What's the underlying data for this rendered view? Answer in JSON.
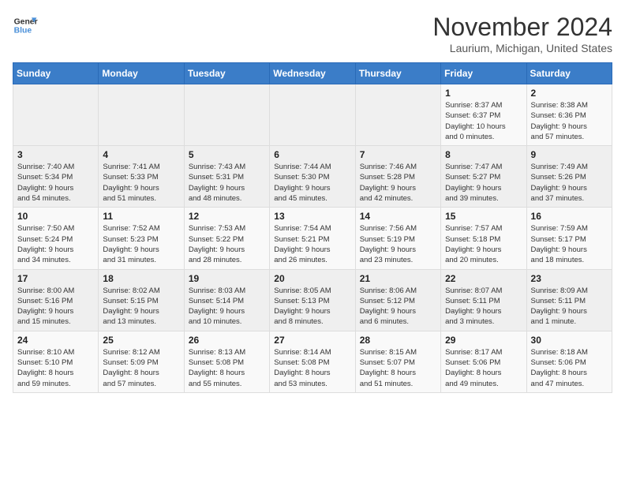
{
  "header": {
    "logo_line1": "General",
    "logo_line2": "Blue",
    "month_year": "November 2024",
    "location": "Laurium, Michigan, United States"
  },
  "weekdays": [
    "Sunday",
    "Monday",
    "Tuesday",
    "Wednesday",
    "Thursday",
    "Friday",
    "Saturday"
  ],
  "weeks": [
    [
      {
        "day": "",
        "info": ""
      },
      {
        "day": "",
        "info": ""
      },
      {
        "day": "",
        "info": ""
      },
      {
        "day": "",
        "info": ""
      },
      {
        "day": "",
        "info": ""
      },
      {
        "day": "1",
        "info": "Sunrise: 8:37 AM\nSunset: 6:37 PM\nDaylight: 10 hours\nand 0 minutes."
      },
      {
        "day": "2",
        "info": "Sunrise: 8:38 AM\nSunset: 6:36 PM\nDaylight: 9 hours\nand 57 minutes."
      }
    ],
    [
      {
        "day": "3",
        "info": "Sunrise: 7:40 AM\nSunset: 5:34 PM\nDaylight: 9 hours\nand 54 minutes."
      },
      {
        "day": "4",
        "info": "Sunrise: 7:41 AM\nSunset: 5:33 PM\nDaylight: 9 hours\nand 51 minutes."
      },
      {
        "day": "5",
        "info": "Sunrise: 7:43 AM\nSunset: 5:31 PM\nDaylight: 9 hours\nand 48 minutes."
      },
      {
        "day": "6",
        "info": "Sunrise: 7:44 AM\nSunset: 5:30 PM\nDaylight: 9 hours\nand 45 minutes."
      },
      {
        "day": "7",
        "info": "Sunrise: 7:46 AM\nSunset: 5:28 PM\nDaylight: 9 hours\nand 42 minutes."
      },
      {
        "day": "8",
        "info": "Sunrise: 7:47 AM\nSunset: 5:27 PM\nDaylight: 9 hours\nand 39 minutes."
      },
      {
        "day": "9",
        "info": "Sunrise: 7:49 AM\nSunset: 5:26 PM\nDaylight: 9 hours\nand 37 minutes."
      }
    ],
    [
      {
        "day": "10",
        "info": "Sunrise: 7:50 AM\nSunset: 5:24 PM\nDaylight: 9 hours\nand 34 minutes."
      },
      {
        "day": "11",
        "info": "Sunrise: 7:52 AM\nSunset: 5:23 PM\nDaylight: 9 hours\nand 31 minutes."
      },
      {
        "day": "12",
        "info": "Sunrise: 7:53 AM\nSunset: 5:22 PM\nDaylight: 9 hours\nand 28 minutes."
      },
      {
        "day": "13",
        "info": "Sunrise: 7:54 AM\nSunset: 5:21 PM\nDaylight: 9 hours\nand 26 minutes."
      },
      {
        "day": "14",
        "info": "Sunrise: 7:56 AM\nSunset: 5:19 PM\nDaylight: 9 hours\nand 23 minutes."
      },
      {
        "day": "15",
        "info": "Sunrise: 7:57 AM\nSunset: 5:18 PM\nDaylight: 9 hours\nand 20 minutes."
      },
      {
        "day": "16",
        "info": "Sunrise: 7:59 AM\nSunset: 5:17 PM\nDaylight: 9 hours\nand 18 minutes."
      }
    ],
    [
      {
        "day": "17",
        "info": "Sunrise: 8:00 AM\nSunset: 5:16 PM\nDaylight: 9 hours\nand 15 minutes."
      },
      {
        "day": "18",
        "info": "Sunrise: 8:02 AM\nSunset: 5:15 PM\nDaylight: 9 hours\nand 13 minutes."
      },
      {
        "day": "19",
        "info": "Sunrise: 8:03 AM\nSunset: 5:14 PM\nDaylight: 9 hours\nand 10 minutes."
      },
      {
        "day": "20",
        "info": "Sunrise: 8:05 AM\nSunset: 5:13 PM\nDaylight: 9 hours\nand 8 minutes."
      },
      {
        "day": "21",
        "info": "Sunrise: 8:06 AM\nSunset: 5:12 PM\nDaylight: 9 hours\nand 6 minutes."
      },
      {
        "day": "22",
        "info": "Sunrise: 8:07 AM\nSunset: 5:11 PM\nDaylight: 9 hours\nand 3 minutes."
      },
      {
        "day": "23",
        "info": "Sunrise: 8:09 AM\nSunset: 5:11 PM\nDaylight: 9 hours\nand 1 minute."
      }
    ],
    [
      {
        "day": "24",
        "info": "Sunrise: 8:10 AM\nSunset: 5:10 PM\nDaylight: 8 hours\nand 59 minutes."
      },
      {
        "day": "25",
        "info": "Sunrise: 8:12 AM\nSunset: 5:09 PM\nDaylight: 8 hours\nand 57 minutes."
      },
      {
        "day": "26",
        "info": "Sunrise: 8:13 AM\nSunset: 5:08 PM\nDaylight: 8 hours\nand 55 minutes."
      },
      {
        "day": "27",
        "info": "Sunrise: 8:14 AM\nSunset: 5:08 PM\nDaylight: 8 hours\nand 53 minutes."
      },
      {
        "day": "28",
        "info": "Sunrise: 8:15 AM\nSunset: 5:07 PM\nDaylight: 8 hours\nand 51 minutes."
      },
      {
        "day": "29",
        "info": "Sunrise: 8:17 AM\nSunset: 5:06 PM\nDaylight: 8 hours\nand 49 minutes."
      },
      {
        "day": "30",
        "info": "Sunrise: 8:18 AM\nSunset: 5:06 PM\nDaylight: 8 hours\nand 47 minutes."
      }
    ]
  ]
}
